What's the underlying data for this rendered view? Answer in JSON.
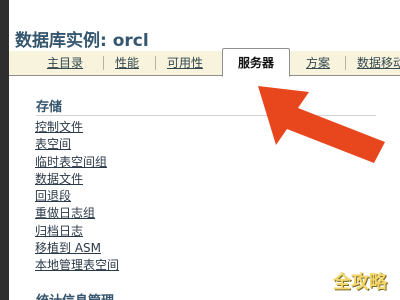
{
  "window": {
    "title": "数据库实例: orcl"
  },
  "tabs": [
    {
      "label": "主目录"
    },
    {
      "label": "性能"
    },
    {
      "label": "可用性"
    },
    {
      "label": "服务器",
      "active": true
    },
    {
      "label": "方案"
    },
    {
      "label": "数据移动"
    }
  ],
  "storage": {
    "heading": "存储",
    "items": [
      {
        "label": "控制文件"
      },
      {
        "label": "表空间"
      },
      {
        "label": "临时表空间组"
      },
      {
        "label": "数据文件"
      },
      {
        "label": "回退段"
      },
      {
        "label": "重做日志组"
      },
      {
        "label": "归档日志"
      },
      {
        "label": "移植到 ASM"
      },
      {
        "label": "本地管理表空间"
      }
    ]
  },
  "next_section": {
    "heading": "统计信息管理"
  },
  "annotation": {
    "arrow_color": "#e8461c"
  },
  "watermark": {
    "text": "全攻略"
  }
}
